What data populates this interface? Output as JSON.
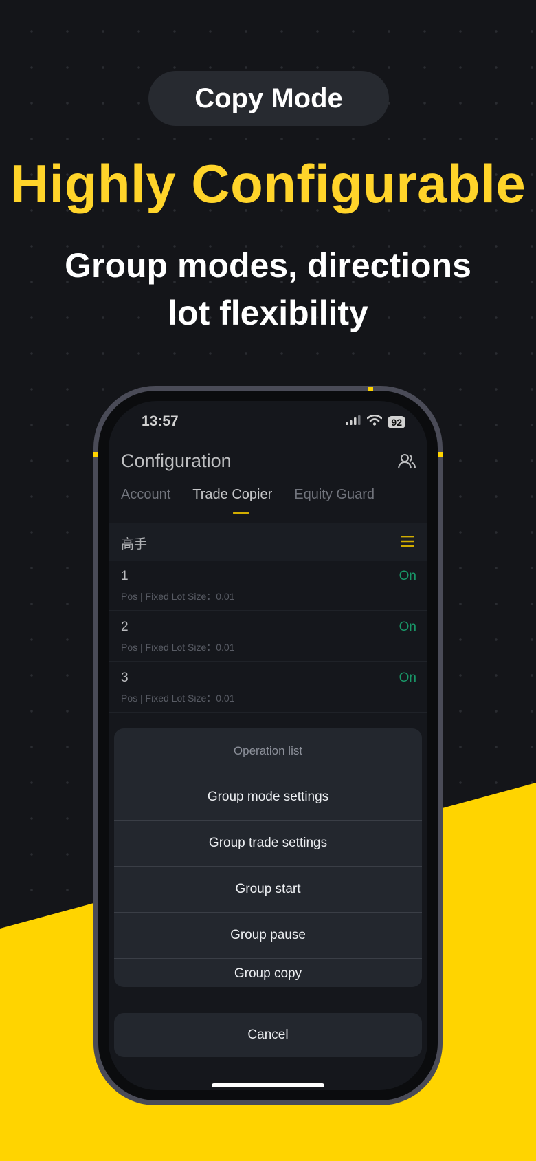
{
  "promo": {
    "pill_label": "Copy Mode",
    "headline": "Highly Configurable",
    "subline1": "Group modes, directions",
    "subline2": "lot flexibility"
  },
  "colors": {
    "accent_yellow": "#FFD400",
    "on_green": "#1fb97f",
    "background": "#141519"
  },
  "status_bar": {
    "time": "13:57",
    "battery": "92"
  },
  "app": {
    "title": "Configuration",
    "tabs": [
      {
        "label": "Account",
        "active": false
      },
      {
        "label": "Trade Copier",
        "active": true
      },
      {
        "label": "Equity Guard",
        "active": false
      }
    ],
    "group_name": "高手",
    "rows": [
      {
        "num": "1",
        "detail": "Pos | Fixed Lot Size：0.01",
        "status": "On"
      },
      {
        "num": "2",
        "detail": "Pos | Fixed Lot Size：0.01",
        "status": "On"
      },
      {
        "num": "3",
        "detail": "Pos | Fixed Lot Size：0.01",
        "status": "On"
      }
    ]
  },
  "sheet": {
    "title": "Operation list",
    "items": [
      "Group mode settings",
      "Group trade settings",
      "Group start",
      "Group pause",
      "Group copy"
    ],
    "cancel": "Cancel"
  },
  "icons": {
    "users": "users-icon",
    "menu": "hamburger-menu-icon",
    "signal": "cellular-signal-icon",
    "wifi": "wifi-icon"
  }
}
